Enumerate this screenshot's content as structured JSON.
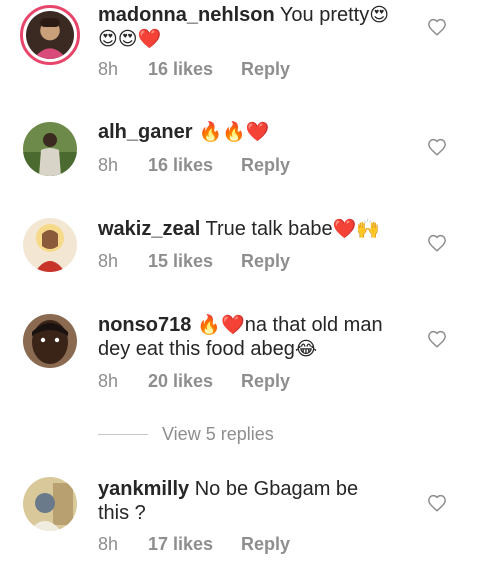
{
  "comments": [
    {
      "username": "madonna_nehlson",
      "text_line1": " You pretty",
      "emoji_line1": "😍",
      "emoji_line2": "😍😍❤️",
      "time": "8h",
      "likes": "16 likes",
      "reply": "Reply",
      "avatar_colors": [
        "#2b1a14",
        "#c9a07a",
        "#d94b7a"
      ]
    },
    {
      "username": "alh_ganer",
      "emoji": " 🔥🔥❤️",
      "time": "8h",
      "likes": "16 likes",
      "reply": "Reply",
      "avatar_colors": [
        "#6e8a4a",
        "#3a2a20",
        "#d9d4c8"
      ]
    },
    {
      "username": "wakiz_zeal",
      "text": " True talk babe",
      "emoji": "❤️🙌",
      "time": "8h",
      "likes": "15 likes",
      "reply": "Reply",
      "avatar_colors": [
        "#f3e7d4",
        "#8a5a3a",
        "#c8342a"
      ]
    },
    {
      "username": "nonso718",
      "emoji_a": " 🔥❤️",
      "text_a": "na that old man",
      "text_b": "dey eat this food abeg",
      "emoji_b": "😂",
      "time": "8h",
      "likes": "20 likes",
      "reply": "Reply",
      "avatar_colors": [
        "#3a2418",
        "#1a1210",
        "#8a6a50"
      ]
    },
    {
      "username": "yankmilly",
      "text_a": " No be Gbagam be",
      "text_b": "this ?",
      "time": "8h",
      "likes": "17 likes",
      "reply": "Reply",
      "avatar_colors": [
        "#d8c89a",
        "#6a7a8a",
        "#f0ece0"
      ]
    }
  ],
  "view_replies": "View 5 replies",
  "icons": {
    "like": "heart-outline-icon"
  },
  "colors": {
    "meta": "#8e8e8e",
    "text": "#262626",
    "story_ring": "#e8456b"
  }
}
